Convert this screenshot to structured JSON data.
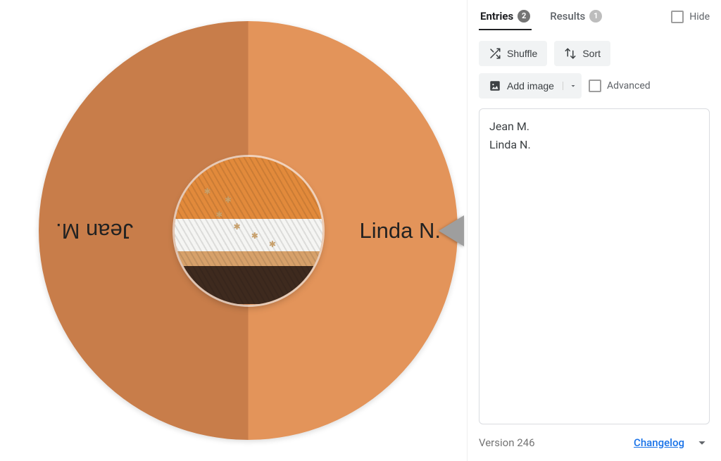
{
  "wheel": {
    "segments": [
      {
        "label": "Jean M.",
        "color": "#C87D4A"
      },
      {
        "label": "Linda N.",
        "color": "#E3945A"
      }
    ],
    "hub_image_desc": "quilted-stripes-photo"
  },
  "tabs": {
    "entries": {
      "label": "Entries",
      "count": 2
    },
    "results": {
      "label": "Results",
      "count": 1
    },
    "hide_label": "Hide"
  },
  "toolbar": {
    "shuffle_label": "Shuffle",
    "sort_label": "Sort",
    "add_image_label": "Add image",
    "advanced_label": "Advanced"
  },
  "entries_text": "Jean M.\nLinda N.",
  "footer": {
    "version_label": "Version 246",
    "changelog_label": "Changelog"
  },
  "chart_data": {
    "type": "pie",
    "title": "",
    "categories": [
      "Jean M.",
      "Linda N."
    ],
    "values": [
      1,
      1
    ],
    "series": [
      {
        "name": "Jean M.",
        "values": [
          1
        ],
        "color": "#C87D4A"
      },
      {
        "name": "Linda N.",
        "values": [
          1
        ],
        "color": "#E3945A"
      }
    ]
  }
}
